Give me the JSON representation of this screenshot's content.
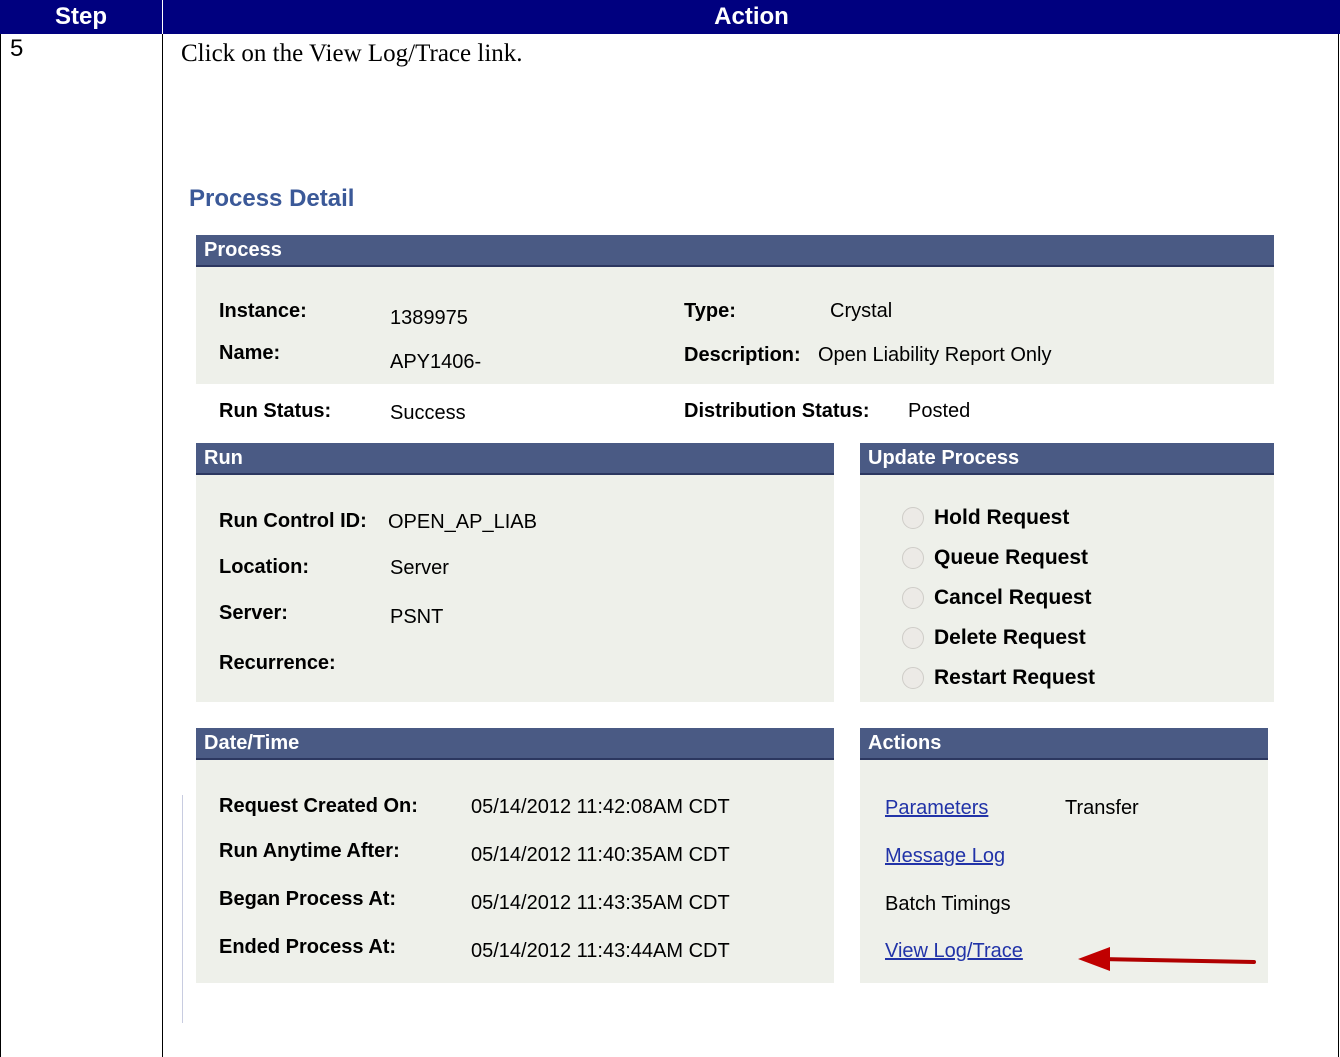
{
  "doc_table": {
    "step_header": "Step",
    "action_header": "Action",
    "step_number": "5",
    "instruction": "Click on the View Log/Trace link."
  },
  "process_detail": {
    "title": "Process Detail",
    "process_section": {
      "header": "Process",
      "instance_label": "Instance:",
      "instance_value": "1389975",
      "name_label": "Name:",
      "name_value": "APY1406-",
      "type_label": "Type:",
      "type_value": "Crystal",
      "description_label": "Description:",
      "description_value": "Open Liability Report Only"
    },
    "run_status_label": "Run Status:",
    "run_status_value": "Success",
    "distribution_status_label": "Distribution Status:",
    "distribution_status_value": "Posted",
    "run_section": {
      "header": "Run",
      "run_control_id_label": "Run Control ID:",
      "run_control_id_value": "OPEN_AP_LIAB",
      "location_label": "Location:",
      "location_value": "Server",
      "server_label": "Server:",
      "server_value": "PSNT",
      "recurrence_label": "Recurrence:"
    },
    "update_process": {
      "header": "Update Process",
      "options": [
        "Hold Request",
        "Queue Request",
        "Cancel Request",
        "Delete Request",
        "Restart Request"
      ]
    },
    "datetime_section": {
      "header": "Date/Time",
      "request_created_label": "Request Created On:",
      "request_created_value": "05/14/2012 11:42:08AM CDT",
      "run_anytime_label": "Run Anytime After:",
      "run_anytime_value": "05/14/2012 11:40:35AM CDT",
      "began_label": "Began Process At:",
      "began_value": "05/14/2012 11:43:35AM CDT",
      "ended_label": "Ended Process At:",
      "ended_value": "05/14/2012 11:43:44AM CDT"
    },
    "actions": {
      "header": "Actions",
      "parameters": "Parameters",
      "transfer": "Transfer",
      "message_log": "Message Log",
      "batch_timings": "Batch Timings",
      "view_log_trace": "View Log/Trace"
    }
  },
  "colors": {
    "doc_header_bg": "#00007f",
    "section_bar_bg": "#4a5a84",
    "panel_bg": "#eef0ea",
    "title_color": "#3b5998",
    "link_color": "#2133a8",
    "arrow_color": "#c00000"
  }
}
